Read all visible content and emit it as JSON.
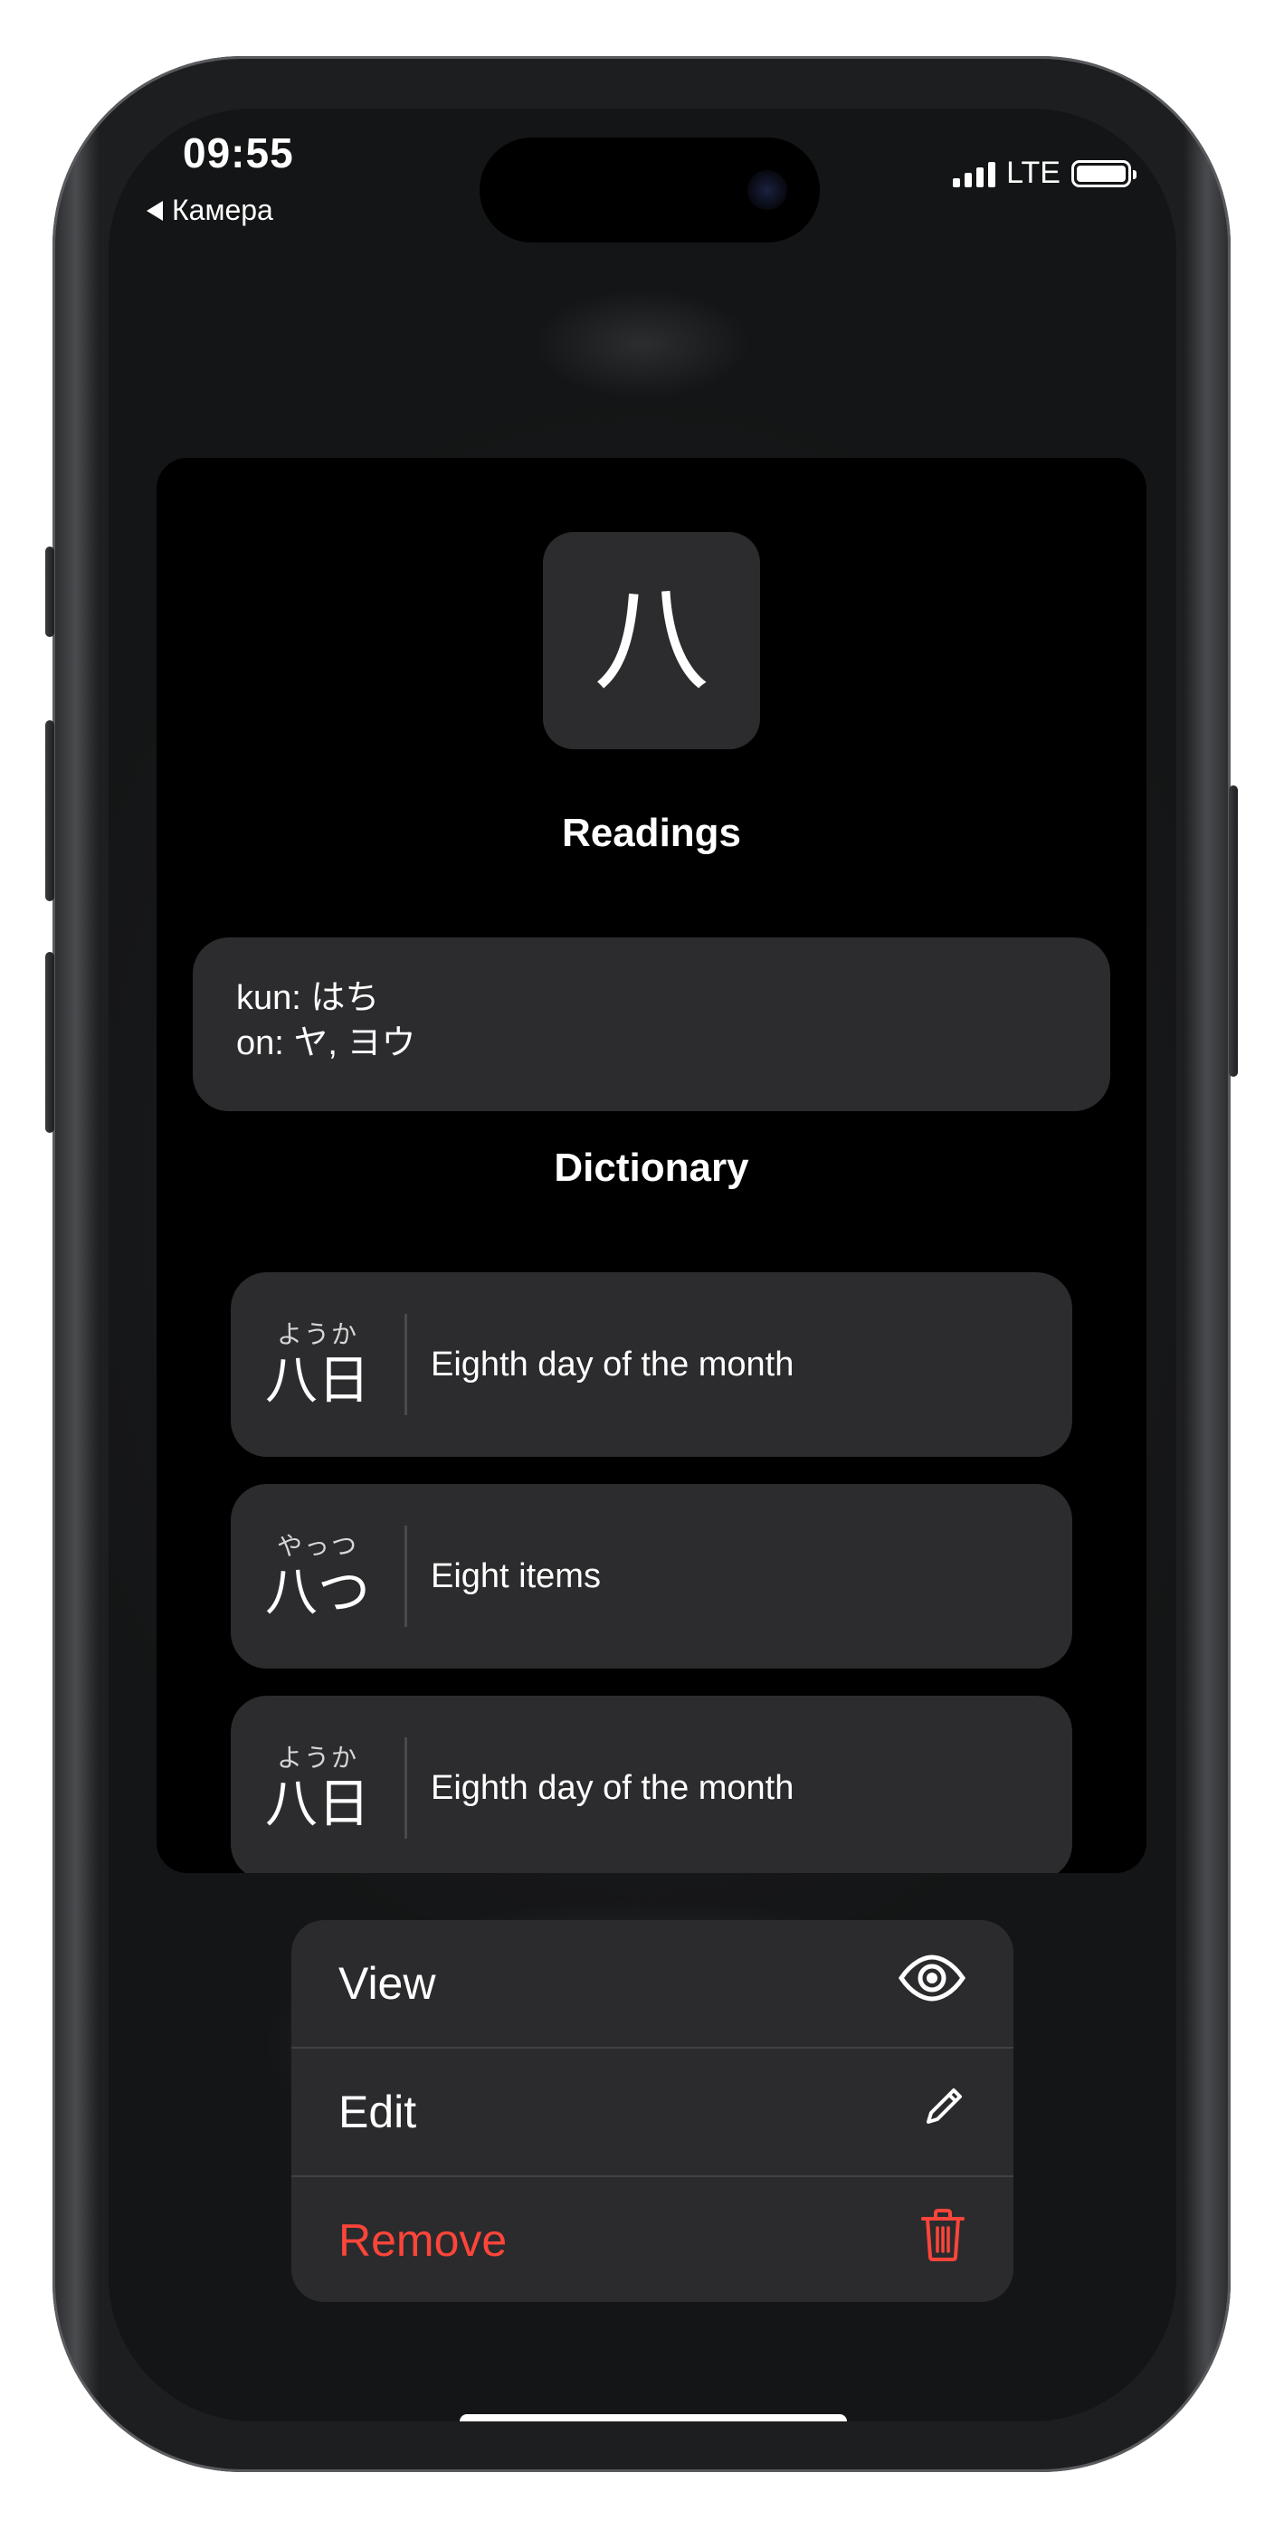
{
  "status_bar": {
    "time": "09:55",
    "back_label": "Камера",
    "network": "LTE"
  },
  "card": {
    "kanji": "八",
    "readings_title": "Readings",
    "readings": {
      "kun": "kun: はち",
      "on": "on: ヤ, ヨウ"
    },
    "dictionary_title": "Dictionary",
    "dictionary": [
      {
        "furigana": "ようか",
        "word": "八日",
        "meaning": "Eighth day of the month"
      },
      {
        "furigana": "やっつ",
        "word": "八つ",
        "meaning": "Eight items"
      },
      {
        "furigana": "ようか",
        "word": "八日",
        "meaning": "Eighth day of the month"
      }
    ]
  },
  "context_menu": {
    "items": [
      {
        "label": "View",
        "icon": "eye-icon"
      },
      {
        "label": "Edit",
        "icon": "pencil-icon"
      },
      {
        "label": "Remove",
        "icon": "trash-icon",
        "destructive": true
      }
    ],
    "destructive_color": "#ff453a"
  },
  "colors": {
    "card_background": "#000000",
    "tile_background": "#2c2c2e",
    "menu_background": "#2b2b2d"
  }
}
